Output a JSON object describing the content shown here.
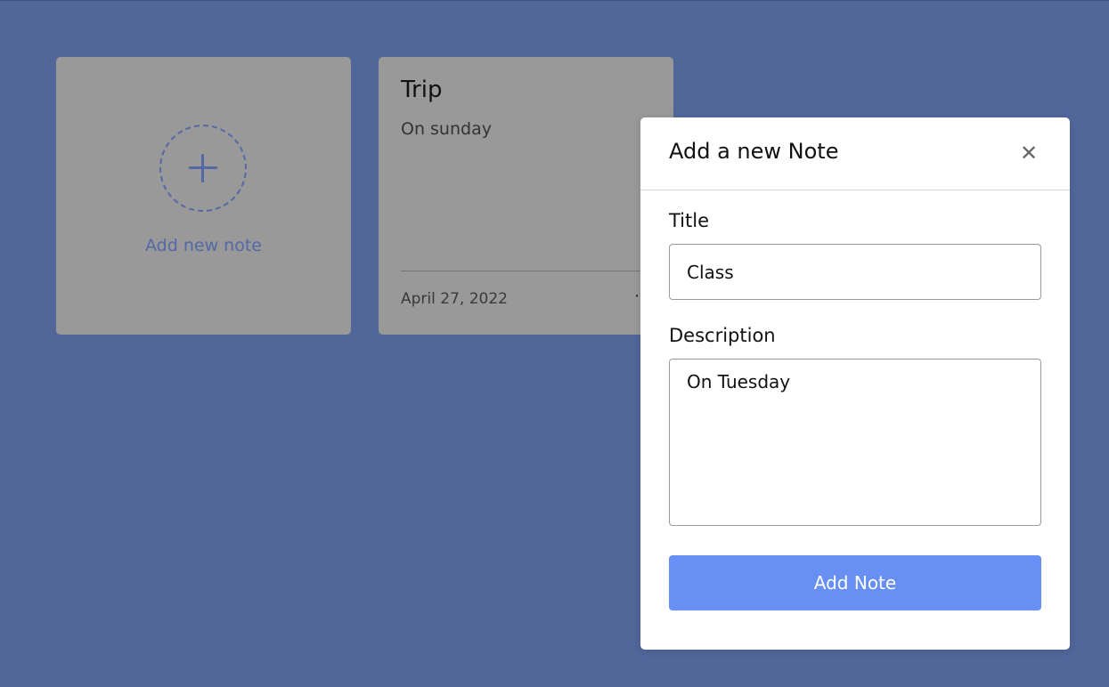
{
  "add_card": {
    "label": "Add new note",
    "icon": "plus-icon"
  },
  "notes": [
    {
      "title": "Trip",
      "description": "On sunday",
      "date": "April 27, 2022",
      "menu": "⋯"
    }
  ],
  "modal": {
    "title": "Add a new Note",
    "close_glyph": "✕",
    "title_label": "Title",
    "title_value": "Class",
    "description_label": "Description",
    "description_value": "On Tuesday",
    "submit_label": "Add Note"
  },
  "colors": {
    "background": "#51679a",
    "card": "#999999",
    "accent": "#5468a6",
    "button": "#6890f4"
  }
}
